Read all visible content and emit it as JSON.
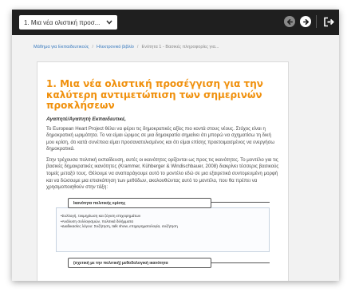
{
  "topbar": {
    "chapter_select": "1. Μια νέα ολιστική προσ...",
    "prev_icon": "arrow-left-circle-icon",
    "next_icon": "arrow-right-circle-icon",
    "exit_icon": "exit-icon"
  },
  "breadcrumb": {
    "items": [
      "Μάθημα για Εκπαιδευτικούς",
      "Ηλεκτρονικό βιβλίο"
    ],
    "current": "Ενότητα 1 - Βασικές πληροφορίες για..."
  },
  "content": {
    "title": "1. Μια νέα ολιστική προσέγγιση για την καλύτερη αντιμετώπιση των σημερινών προκλήσεων",
    "subheading": "Αγαπητέ/Αγαπητή Εκπαιδευτικέ,",
    "paragraphs": [
      "Το European Heart Project θέλει να φέρει τις δημοκρατικές αξίες πιο κοντά στους νέους. Στόχος είναι η δημοκρατική ωριμότητα. Το να είμαι ώριμος σε μια δημοκρατία σημαίνει ότι μπορώ να σχηματίσω τη δική μου κρίση, ότι κατά συνέπεια είμαι προσανατολισμένος και ότι είμαι επίσης προετοιμασμένος να ενεργήσω δημοκρατικά.",
      "Στην τρέχουσα πολιτική εκπαίδευση, αυτές οι ικανότητες ορίζονται ως προς τις ικανότητες. Το μοντέλο για τις βασικές δημοκρατικές ικανότητες (Krammer, Kühberger & Windischbauer, 2008) διακρίνει τέσσερις βασικούς τομείς μεταξύ τους. Θέλουμε να αναπαράγουμε αυτό το μοντέλο εδώ σε μια εξαιρετικά συντομευμένη μορφή και να δώσουμε μια επισκόπηση των μεθόδων, ακολουθώντας αυτό το μοντέλο, που θα πρέπει να χρησιμοποιηθούν στην τάξη:"
    ],
    "diagram": {
      "box1_title": "Ικανότητα πολιτικής κρίσης",
      "box1_bullets": [
        "•Συλλογή, τεκμηρίωση και ζύγιση επιχειρημάτων",
        "•Ανάλυση συλλογισμών, πολιτικά διλήμματα",
        "•Διαδικασίες λόγου: Συζήτηση, talk show, επιχειρηματολογία, συζήτηση"
      ],
      "box2_title": "(σχετική με την πολιτική) μεθοδολογική ικανότητα"
    }
  }
}
